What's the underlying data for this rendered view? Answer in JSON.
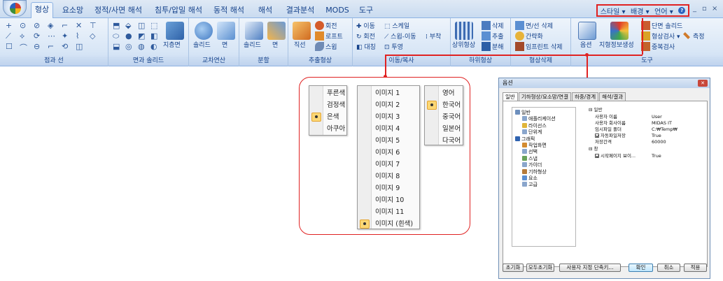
{
  "ribbon": {
    "tabs": [
      "형상",
      "요소망",
      "정적/사면 해석",
      "침투/압밀 해석",
      "동적 해석",
      "해석",
      "결과분석",
      "MODS",
      "도구"
    ],
    "active_tab": 0,
    "right_menu": {
      "style": "스타일",
      "background": "배경",
      "language": "언어",
      "help": "?"
    },
    "window_controls": {
      "minimize": "_",
      "restore": "▫",
      "close": "×"
    },
    "groups": {
      "point_line": "점과 선",
      "surface_solid": "면과 솔리드",
      "intersection": "교차연산",
      "divide": "분할",
      "extract": "추출형상",
      "move_copy": "이동/복사",
      "sub_shape": "하위형상",
      "shape_delete": "형상삭제",
      "tools": "도구"
    },
    "buttons": {
      "extrude_surface": "지층면",
      "solid": "솔리드",
      "face": "면",
      "solid2": "솔리드",
      "face2": "면",
      "line": "직선",
      "rotate": "회전",
      "loft": "로프트",
      "sweep": "스윕",
      "move": "이동",
      "rotate2": "회전",
      "mirror": "대칭",
      "scale": "스케일",
      "sweep_move": "스윕-이동",
      "project": "투영",
      "attach": "부착",
      "parent_shape": "상위형상",
      "del": "삭제",
      "extract2": "추출",
      "decompose": "분해",
      "face_line_delete": "면/선 삭제",
      "simplify": "간략화",
      "imprint_delete": "임프린트 삭제",
      "options": "옵션",
      "terrain": "지형정보생성",
      "section_solid": "단면 솔리드",
      "shape_check": "형상검사",
      "measure": "측정",
      "overlap_check": "중복검사"
    }
  },
  "style_menu": {
    "items": [
      "푸른색",
      "검정색",
      "은색",
      "아쿠아"
    ],
    "selected": 2
  },
  "background_menu": {
    "items": [
      "이미지 1",
      "이미지 2",
      "이미지 3",
      "이미지 4",
      "이미지 5",
      "이미지 6",
      "이미지 7",
      "이미지 8",
      "이미지 9",
      "이미지 10",
      "이미지 11",
      "이미지 (흰색)"
    ],
    "selected": 11
  },
  "language_menu": {
    "items": [
      "영어",
      "한국어",
      "중국어",
      "일본어",
      "다국어"
    ],
    "selected": 1
  },
  "options_dialog": {
    "title": "옵션",
    "close": "✕",
    "tabs": [
      "일반",
      "기하형상/요소망/연결",
      "하중/경계",
      "해석/결과"
    ],
    "tree": [
      "일반",
      "애플리케이션",
      "라이선스",
      "단위계",
      "그래픽",
      "작업화면",
      "선택",
      "스냅",
      "가이더",
      "기하형상",
      "요소",
      "고급"
    ],
    "props": {
      "section_general": "일반",
      "username_k": "사용자 이름",
      "username_v": "User",
      "company_k": "사용자 회사이름",
      "company_v": "MIDAS IT",
      "temp_k": "임시파일 폴더",
      "temp_v": "C:₩Temp₩",
      "autosave_k": "자동파일저장",
      "autosave_v": "True",
      "interval_k": "저장간격",
      "interval_v": "60000",
      "section_window": "창",
      "startup_k": "시작페이지 보이...",
      "startup_v": "True"
    },
    "buttons": {
      "reset": "초기화",
      "reset_all": "모두초기화",
      "shortcuts": "사용자 지정 단축키...",
      "ok": "확인",
      "cancel": "취소",
      "apply": "적용"
    }
  },
  "colors": {
    "highlight": "#e02222",
    "ribbon": "#d8e6f6",
    "check": "#fbd775"
  }
}
